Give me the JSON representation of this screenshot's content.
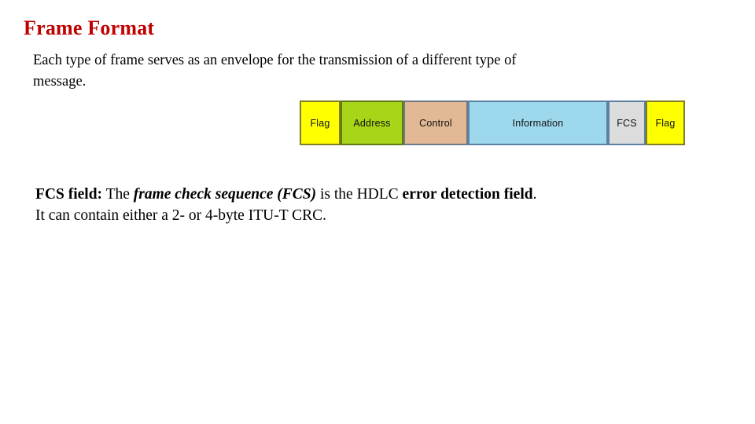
{
  "slide": {
    "title": "Frame Format",
    "title_color": "#C00000",
    "background": "#FFFFFF"
  },
  "intro": {
    "line1": "Each type of frame serves as an envelope for the transmission of a different type of",
    "line2": "message."
  },
  "frame_diagram": {
    "name": "HDLC frame format",
    "cells": [
      {
        "label": "Flag",
        "fill": "#FFFF00",
        "border": "#7E7E22"
      },
      {
        "label": "Address",
        "fill": "#A8D517",
        "border": "#5F7A13"
      },
      {
        "label": "Control",
        "fill": "#E2B895",
        "border": "#6C7A88"
      },
      {
        "label": "Information",
        "fill": "#9ED8ED",
        "border": "#5B82A4"
      },
      {
        "label": "FCS",
        "fill": "#DCDCDC",
        "border": "#5B82A4"
      },
      {
        "label": "Flag",
        "fill": "#FFFF00",
        "border": "#7E7E22"
      }
    ]
  },
  "fcs_note": {
    "label": "FCS field:",
    "text_the": "The",
    "emphasis": "frame check sequence (FCS)",
    "text_mid": "is the HDLC",
    "bold_tail": "error detection field",
    "period": ".",
    "line2": "It can contain either a 2- or 4-byte ITU-T CRC."
  }
}
